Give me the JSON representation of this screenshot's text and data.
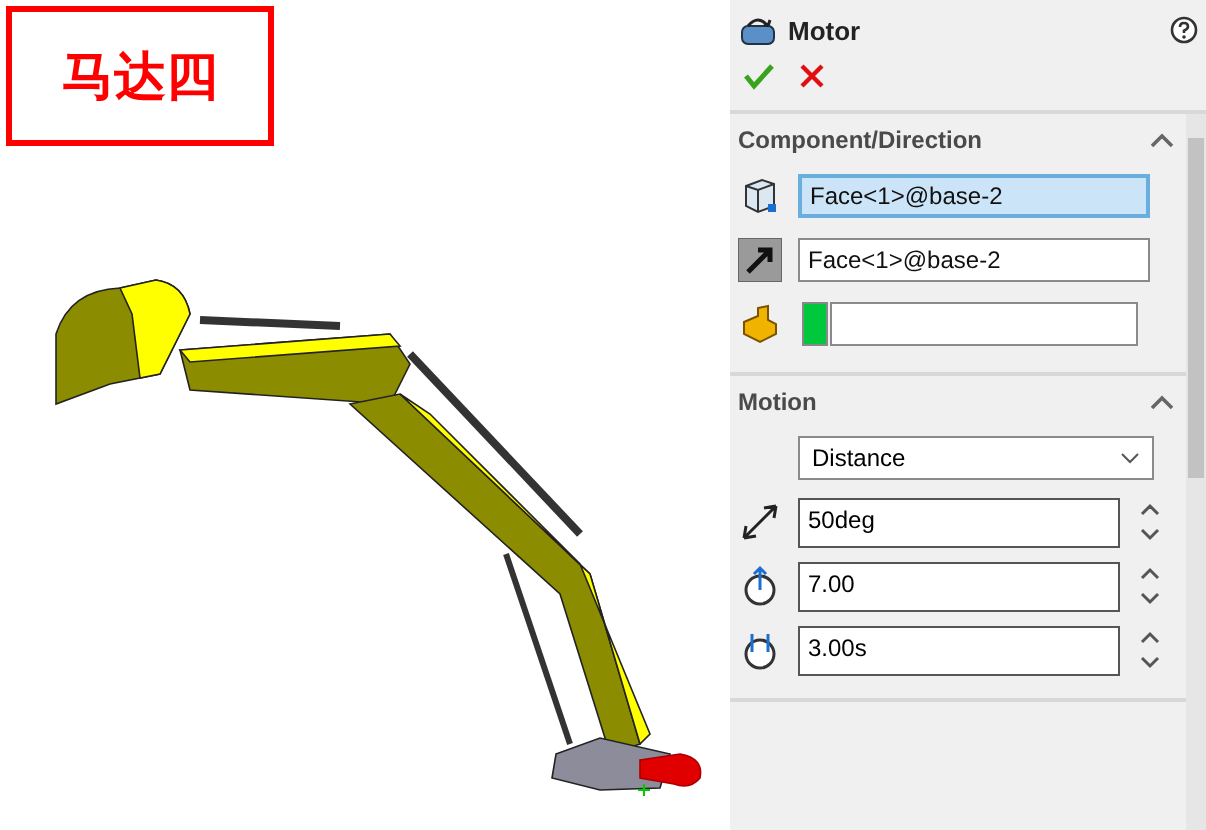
{
  "canvas": {
    "title_box": "马达四"
  },
  "panel": {
    "title": "Motor",
    "sections": [
      {
        "title": "Component/Direction",
        "expanded": true,
        "rows": [
          {
            "kind": "face",
            "value": "Face<1>@base-2",
            "selected": true
          },
          {
            "kind": "direction",
            "value": "Face<1>@base-2",
            "selected": false
          },
          {
            "kind": "color",
            "color": "#00c83c"
          }
        ]
      },
      {
        "title": "Motion",
        "expanded": true,
        "rows": [
          {
            "kind": "dropdown",
            "value": "Distance"
          },
          {
            "kind": "distance",
            "value": "50deg"
          },
          {
            "kind": "start",
            "value": "7.00"
          },
          {
            "kind": "duration",
            "value": "3.00s"
          }
        ]
      }
    ]
  }
}
